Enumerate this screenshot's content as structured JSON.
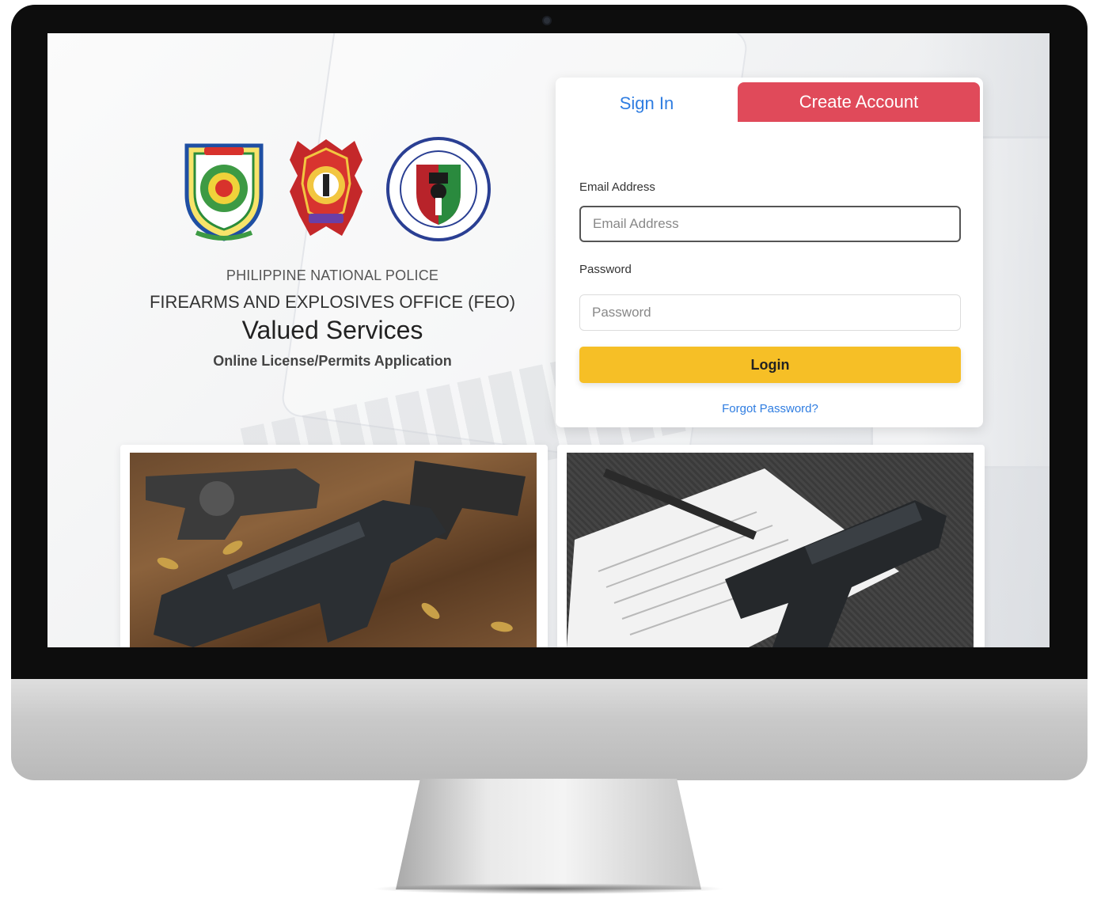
{
  "header": {
    "agency": "PHILIPPINE NATIONAL POLICE",
    "office": "FIREARMS AND EXPLOSIVES OFFICE (FEO)",
    "services": "Valued Services",
    "tagline": "Online License/Permits Application"
  },
  "logos": [
    "pnp-feo-seal-icon",
    "pnp-badge-icon",
    "civil-security-group-seal-icon"
  ],
  "tabs": {
    "signin": "Sign In",
    "create": "Create Account"
  },
  "form": {
    "email_label": "Email Address",
    "email_placeholder": "Email Address",
    "password_label": "Password",
    "password_placeholder": "Password",
    "login": "Login",
    "forgot": "Forgot Password?"
  },
  "colors": {
    "signin_tab": "#2f7de1",
    "create_tab": "#e04a5a",
    "login_button": "#f6bf26",
    "link": "#2f7de1"
  }
}
